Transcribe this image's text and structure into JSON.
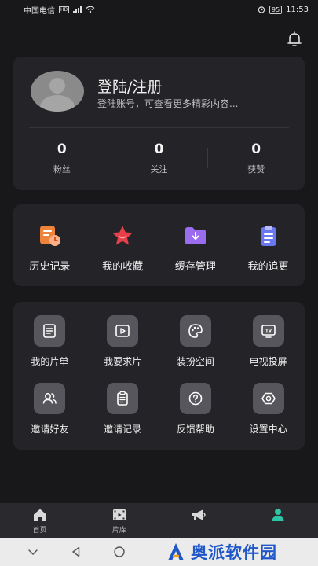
{
  "status_bar": {
    "carrier": "中国电信",
    "hd": "HD",
    "battery": "95",
    "time": "11:53"
  },
  "profile": {
    "title": "登陆/注册",
    "subtitle": "登陆账号，可查看更多精彩内容...",
    "stats": [
      {
        "value": "0",
        "label": "粉丝"
      },
      {
        "value": "0",
        "label": "关注"
      },
      {
        "value": "0",
        "label": "获赞"
      }
    ]
  },
  "quick_actions": [
    {
      "label": "历史记录",
      "icon": "history-icon",
      "color": "#f0833a"
    },
    {
      "label": "我的收藏",
      "icon": "star-icon",
      "color": "#e8404a"
    },
    {
      "label": "缓存管理",
      "icon": "download-folder-icon",
      "color": "#9a6cf0"
    },
    {
      "label": "我的追更",
      "icon": "clipboard-icon",
      "color": "#6a78ef"
    }
  ],
  "tools": [
    {
      "label": "我的片单",
      "icon": "list-icon"
    },
    {
      "label": "我要求片",
      "icon": "play-icon"
    },
    {
      "label": "装扮空间",
      "icon": "palette-icon"
    },
    {
      "label": "电视投屏",
      "icon": "tv-icon"
    },
    {
      "label": "邀请好友",
      "icon": "users-icon"
    },
    {
      "label": "邀请记录",
      "icon": "record-icon"
    },
    {
      "label": "反馈帮助",
      "icon": "help-icon"
    },
    {
      "label": "设置中心",
      "icon": "settings-icon"
    }
  ],
  "tabbar": [
    {
      "label": "首页",
      "icon": "home-icon"
    },
    {
      "label": "片库",
      "icon": "film-icon"
    },
    {
      "label": "",
      "icon": "megaphone-icon"
    },
    {
      "label": "",
      "icon": "profile-icon",
      "active_color": "#2ec4a6"
    }
  ],
  "watermark": {
    "text": "奥派软件园"
  }
}
